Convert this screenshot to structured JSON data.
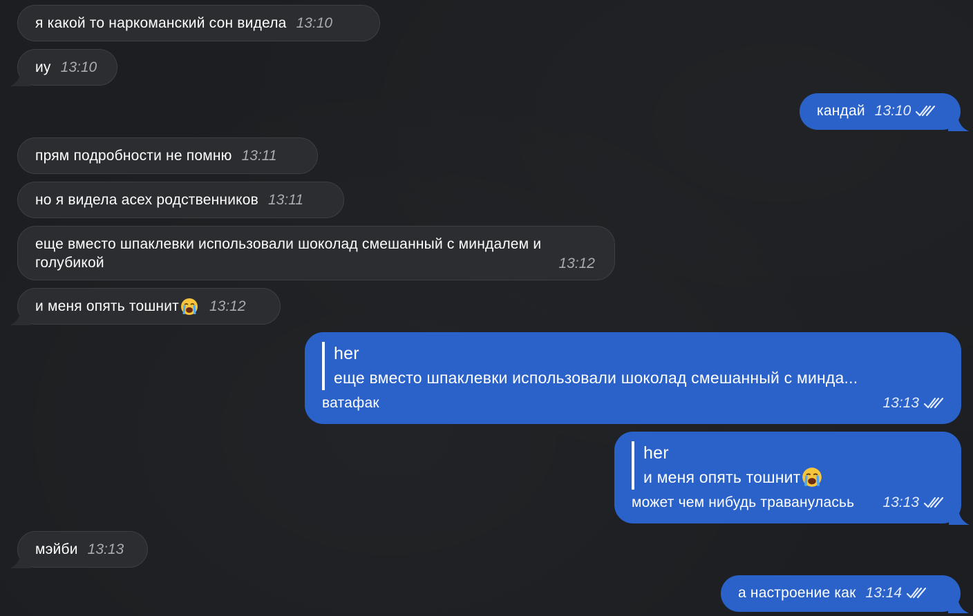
{
  "messages": [
    {
      "id": "m1",
      "dir": "in",
      "text": "я какой то наркоманский сон видела",
      "time": "13:10"
    },
    {
      "id": "m2",
      "dir": "in",
      "text": "иу",
      "time": "13:10"
    },
    {
      "id": "m3",
      "dir": "out",
      "text": "кандай",
      "time": "13:10",
      "status_icon": "double-check-icon"
    },
    {
      "id": "m4",
      "dir": "in",
      "text": "прям подробности не помню",
      "time": "13:11"
    },
    {
      "id": "m5",
      "dir": "in",
      "text": "но я видела асех родственников",
      "time": "13:11"
    },
    {
      "id": "m6",
      "dir": "in",
      "text_line1": "еще вместо шпаклевки использовали шоколад смешанный с миндалем и",
      "text_line2": "голубикой",
      "time": "13:12"
    },
    {
      "id": "m7",
      "dir": "in",
      "text": "и меня опять тошнит",
      "emoji": "crying-face-emoji",
      "time": "13:12"
    },
    {
      "id": "m8",
      "dir": "out",
      "reply_to": {
        "name": "her",
        "text": "еще вместо шпаклевки использовали шоколад смешанный с минда..."
      },
      "text": "ватафак",
      "time": "13:13",
      "status_icon": "double-check-icon"
    },
    {
      "id": "m9",
      "dir": "out",
      "reply_to": {
        "name": "her",
        "text": "и меня опять тошнит",
        "emoji": "crying-face-emoji"
      },
      "text": "может чем нибудь травануласьь",
      "time": "13:13",
      "status_icon": "double-check-icon"
    },
    {
      "id": "m10",
      "dir": "in",
      "text": "мэйби",
      "time": "13:13"
    },
    {
      "id": "m11",
      "dir": "out",
      "text": "а настроение как",
      "time": "13:14",
      "status_icon": "double-check-icon"
    }
  ],
  "colors": {
    "background": "#1c1e21",
    "incoming_bubble": "#2b2d30",
    "outgoing_bubble": "#2a62c9"
  }
}
